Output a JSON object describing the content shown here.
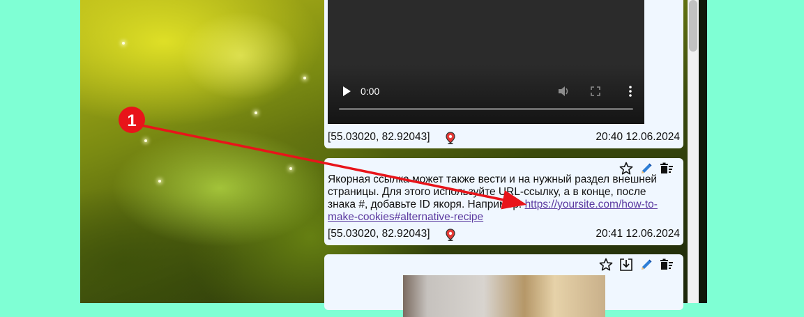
{
  "video_post": {
    "player": {
      "current_time": "0:00"
    },
    "coords": "[55.03020, 82.92043]",
    "datetime": "20:40 12.06.2024"
  },
  "text_post": {
    "body_text": "Якорная ссылка может также вести и на нужный раздел внешней страницы. Для этого используйте URL-ссылку, а в конце, после знака #, добавьте ID якоря. Например: ",
    "link_text": "https://yoursite.com/how-to-make-cookies#alternative-recipe",
    "coords": "[55.03020, 82.92043]",
    "datetime": "20:41 12.06.2024"
  },
  "annotation": {
    "marker_number": "1",
    "color": "#e8141a"
  },
  "icons": {
    "favorite": "star-outline-icon",
    "download": "download-icon",
    "edit": "pencil-icon",
    "delete": "delete-sweep-icon",
    "location": "map-pin-icon"
  },
  "colors": {
    "page_bg": "#7fffd4",
    "card_bg": "#f0f7ff",
    "link": "#5b3aa0"
  }
}
